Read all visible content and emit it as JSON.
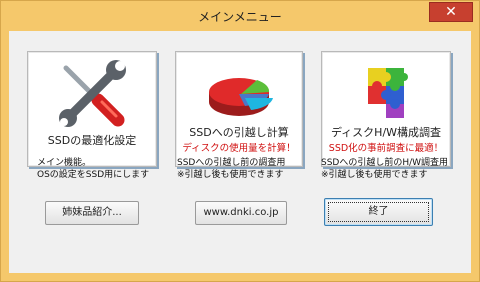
{
  "window": {
    "title": "メインメニュー",
    "close_glyph": "✕"
  },
  "tiles": [
    {
      "label": "SSDの最適化設定",
      "sublabel": "",
      "icon": "wrench-screwdriver-icon",
      "description": [
        "メイン機能。",
        "OSの設定をSSD用にします"
      ]
    },
    {
      "label": "SSDへの引越し計算",
      "sublabel": "ディスクの使用量を計算！",
      "icon": "pie-chart-icon",
      "description": [
        "SSDへの引越し前の調査用",
        "※引越し後も使用できます"
      ]
    },
    {
      "label": "ディスクH/W構成調査",
      "sublabel": "SSD化の事前調査に最適！",
      "icon": "puzzle-icon",
      "description": [
        "SSDへの引越し前のH/W調査用",
        "※引越し後も使用できます"
      ]
    }
  ],
  "buttons": {
    "sister_products": "姉妹品紹介...",
    "website": "www.dnki.co.jp",
    "exit": "終了"
  },
  "colors": {
    "sublabel_red": "#d01010",
    "title_bar": "#f5c86b",
    "close_red": "#c7402f"
  }
}
